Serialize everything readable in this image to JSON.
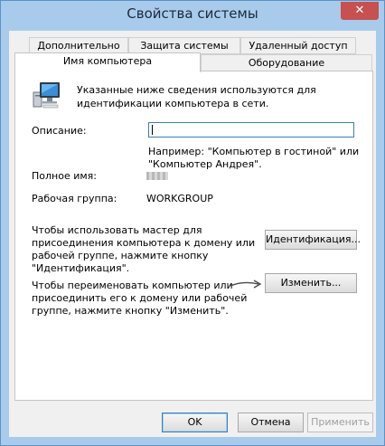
{
  "window": {
    "title": "Свойства системы",
    "close_glyph": "✕"
  },
  "tabs": {
    "row_top": [
      "Дополнительно",
      "Защита системы",
      "Удаленный доступ"
    ],
    "row_bottom": [
      "Имя компьютера",
      "Оборудование"
    ],
    "active": "Имя компьютера"
  },
  "panel": {
    "intro_line1": "Указанные ниже сведения используются для",
    "intro_line2": "идентификации компьютера в сети.",
    "description_label": "Описание:",
    "description_value": "",
    "example_line1": "Например: \"Компьютер в гостиной\" или",
    "example_line2": "\"Компьютер Андрея\".",
    "fullname_label": "Полное имя:",
    "workgroup_label": "Рабочая группа:",
    "workgroup_value": "WORKGROUP",
    "wizard_text": [
      "Чтобы использовать мастер для",
      "присоединения компьютера к домену или",
      "рабочей группе, нажмите кнопку",
      "\"Идентификация\"."
    ],
    "identify_button": "Идентификация...",
    "rename_text": [
      "Чтобы переименовать компьютер или",
      "присоединить его к домену или рабочей",
      "группе, нажмите кнопку \"Изменить\"."
    ],
    "change_button": "Изменить..."
  },
  "footer": {
    "ok": "OK",
    "cancel": "Отмена",
    "apply": "Применить"
  },
  "colors": {
    "frame": "#a8cbec",
    "close": "#c75050",
    "focus_border": "#3c7fb1"
  },
  "icons": [
    "computer-icon",
    "arrow-icon"
  ]
}
